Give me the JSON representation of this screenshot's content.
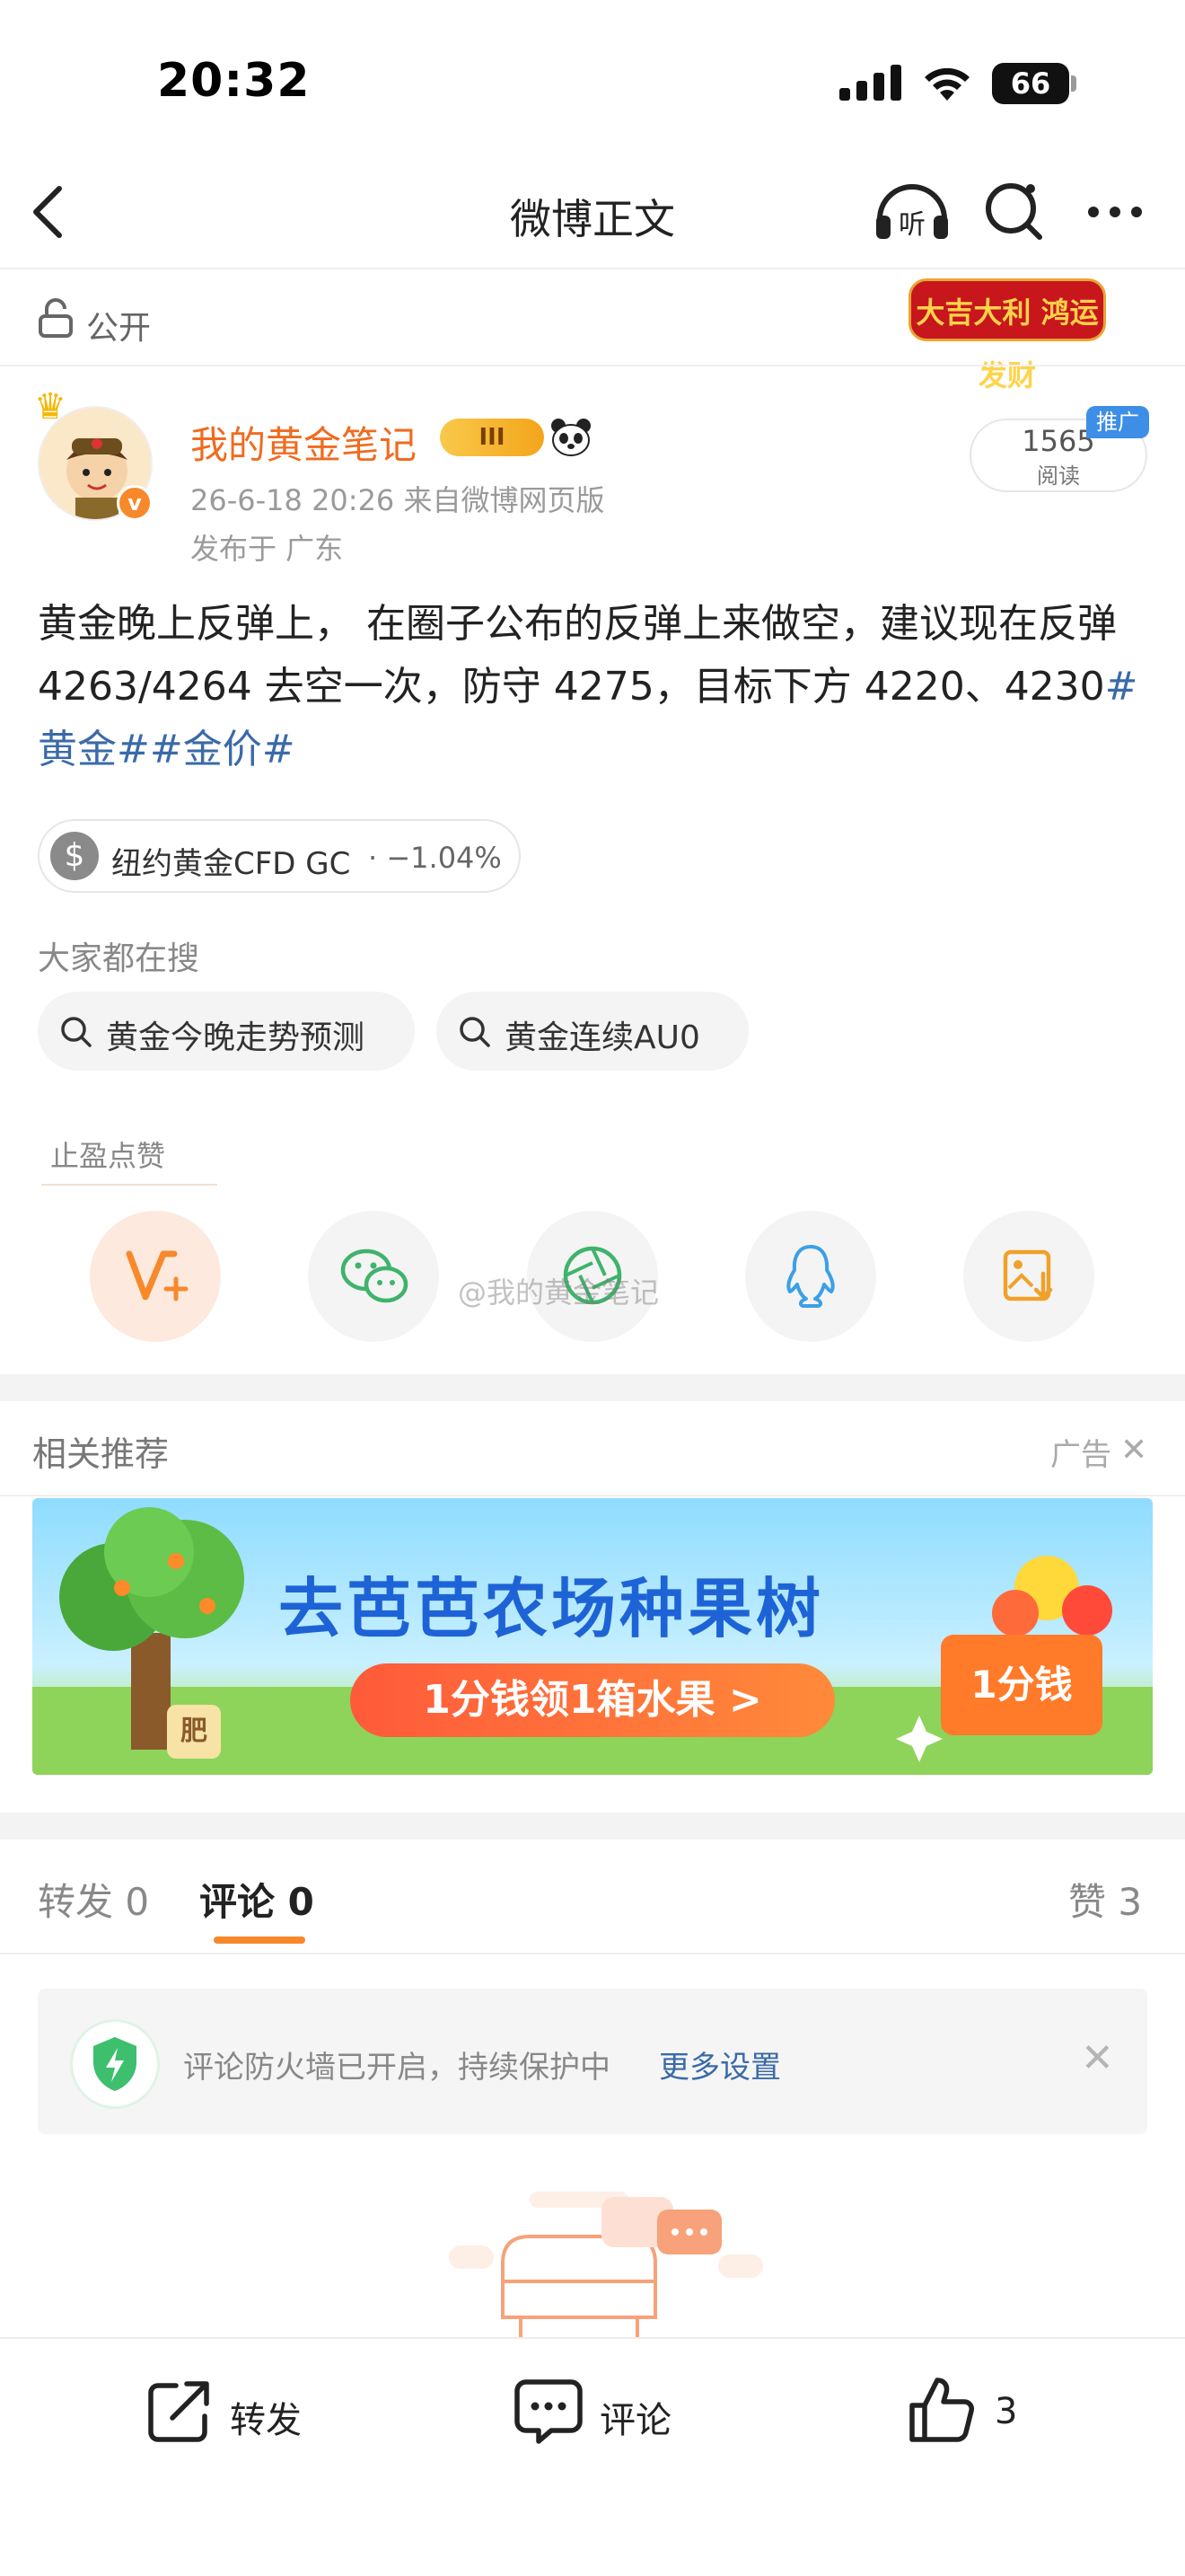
{
  "status_bar": {
    "time": "20:32",
    "battery": "66"
  },
  "nav": {
    "title": "微博正文",
    "listen_label": "听"
  },
  "visibility": {
    "label": "公开",
    "banner_text": "大吉大利 鸿运发财"
  },
  "author": {
    "name": "我的黄金笔记",
    "vip_level": "III",
    "meta": "26-6-18 20:26  来自微博网页版",
    "location": "发布于 广东",
    "reads_count": "1565",
    "reads_label": "阅读",
    "promo_tag": "推广"
  },
  "post": {
    "text": "黄金晚上反弹上， 在圈子公布的反弹上来做空，建议现在反弹 4263/4264 去空一次，防守 4275，目标下方 4220、4230",
    "hashtags": "#黄金##金价#"
  },
  "stock": {
    "name": "纽约黄金CFD GC",
    "change": "· −1.04%"
  },
  "search": {
    "heading": "大家都在搜",
    "chips": [
      "黄金今晚走势预测",
      "黄金连续AU0"
    ]
  },
  "share": {
    "like_hint": "止盈点赞",
    "watermark": "@我的黄金笔记"
  },
  "recommend": {
    "heading": "相关推荐",
    "ad_label": "广告",
    "ad_title": "去芭芭农场种果树",
    "ad_cta": "1分钱领1箱水果 >",
    "ad_box": "1分钱",
    "ad_tree_tag": "肥"
  },
  "tabs": {
    "repost": "转发 0",
    "comment": "评论 0",
    "like": "赞 3"
  },
  "firewall": {
    "text": "评论防火墙已开启，持续保护中",
    "link": "更多设置"
  },
  "bottom_bar": {
    "repost": "转发",
    "comment": "评论",
    "like": "3"
  },
  "colors": {
    "accent": "#f7892b",
    "link": "#3a6aa8",
    "author": "#f06b1f"
  }
}
